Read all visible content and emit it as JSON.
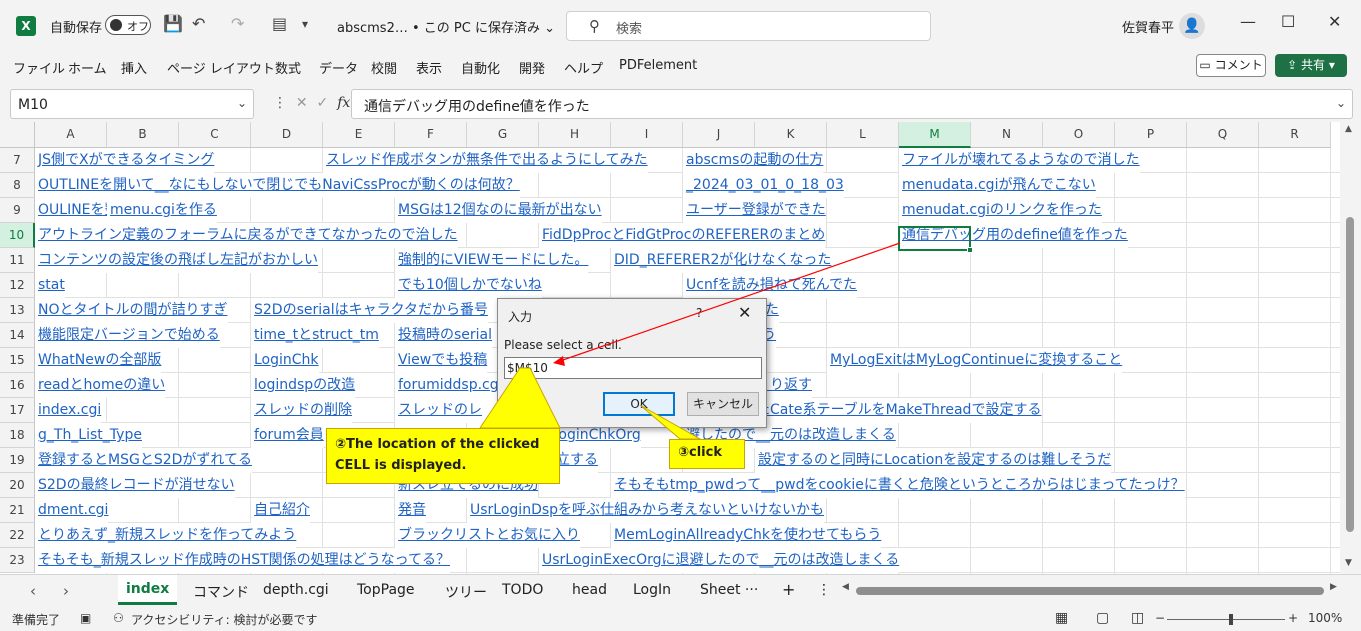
{
  "titlebar": {
    "app_icon": "X",
    "autosave_label": "自動保存",
    "autosave_state": "オフ",
    "doc_title": "abscms2… • この PC に保存済み ⌄",
    "search_placeholder": "検索",
    "user_name": "佐賀春平"
  },
  "ribbon": {
    "tabs": [
      "ファイル",
      "ホーム",
      "挿入",
      "ページ レイアウト",
      "数式",
      "データ",
      "校閲",
      "表示",
      "自動化",
      "開発",
      "ヘルプ",
      "PDFelement"
    ],
    "comment_label": "コメント",
    "share_label": "共有"
  },
  "formula_bar": {
    "name_box": "M10",
    "value": "通信デバッグ用のdefine値を作った"
  },
  "grid": {
    "columns": [
      "A",
      "B",
      "C",
      "D",
      "E",
      "F",
      "G",
      "H",
      "I",
      "J",
      "K",
      "L",
      "M",
      "N",
      "O",
      "P",
      "Q",
      "R"
    ],
    "selected_column": "M",
    "rows": [
      "7",
      "8",
      "9",
      "10",
      "11",
      "12",
      "13",
      "14",
      "15",
      "16",
      "17",
      "18",
      "19",
      "20",
      "21",
      "22",
      "23"
    ],
    "selected_row": "10",
    "cells": [
      {
        "row": "7",
        "col": "A",
        "text": "JS側でXができるタイミング"
      },
      {
        "row": "7",
        "col": "E",
        "text": "スレッド作成ボタンが無条件で出るようにしてみた"
      },
      {
        "row": "7",
        "col": "J",
        "text": "abscmsの起動の仕方"
      },
      {
        "row": "7",
        "col": "M",
        "text": "ファイルが壊れてるようなので消した"
      },
      {
        "row": "8",
        "col": "A",
        "text": "OUTLINEを開いて__なにもしないで閉じでもNaviCssProcが動くのは何故？"
      },
      {
        "row": "8",
        "col": "J",
        "text": "_2024_03_01_0_18_03"
      },
      {
        "row": "8",
        "col": "M",
        "text": "menudata.cgiが飛んでこない"
      },
      {
        "row": "9",
        "col": "A",
        "text": "OULINEを整理せよ"
      },
      {
        "row": "9",
        "col": "B",
        "text": "menu.cgiを作る"
      },
      {
        "row": "9",
        "col": "F",
        "text": "MSGは12個なのに最新が出ない"
      },
      {
        "row": "9",
        "col": "J",
        "text": "ユーザー登録ができた"
      },
      {
        "row": "9",
        "col": "M",
        "text": "menudat.cgiのリンクを作った"
      },
      {
        "row": "10",
        "col": "A",
        "text": "アウトライン定義のフォーラムに戻るができてなかったので治した"
      },
      {
        "row": "10",
        "col": "H",
        "text": "FidDpProcとFidGtProcのREFERERのまとめ"
      },
      {
        "row": "10",
        "col": "M",
        "text": "通信デバッグ用のdefine値を作った"
      },
      {
        "row": "11",
        "col": "A",
        "text": "コンテンツの設定後の飛ばし左記がおかしい"
      },
      {
        "row": "11",
        "col": "F",
        "text": "強制的にVIEWモードにした。"
      },
      {
        "row": "11",
        "col": "I",
        "text": "DID_REFERER2が化けなくなった"
      },
      {
        "row": "12",
        "col": "A",
        "text": "stat"
      },
      {
        "row": "12",
        "col": "F",
        "text": "でも10個しかでないね"
      },
      {
        "row": "12",
        "col": "J",
        "text": "Ucnfを読み損ねて死んでた"
      },
      {
        "row": "13",
        "col": "A",
        "text": "NOとタイトルの間が詰りすぎ"
      },
      {
        "row": "13",
        "col": "D",
        "text": "S2Dのserialはキャラクタだから番号"
      },
      {
        "row": "13",
        "col": "J",
        "text": "pを表示できた"
      },
      {
        "row": "14",
        "col": "A",
        "text": "機能限定バージョンで始める"
      },
      {
        "row": "14",
        "col": "D",
        "text": "time_tとstruct_tm"
      },
      {
        "row": "14",
        "col": "F",
        "text": "投稿時のserial"
      },
      {
        "row": "14",
        "col": "J",
        "text": "らsidを取ろう"
      },
      {
        "row": "15",
        "col": "A",
        "text": "WhatNewの全部版"
      },
      {
        "row": "15",
        "col": "D",
        "text": "LoginChk"
      },
      {
        "row": "15",
        "col": "F",
        "text": "Viewでも投稿"
      },
      {
        "row": "15",
        "col": "L",
        "text": "MyLogExitはMyLogContinueに変換すること"
      },
      {
        "row": "16",
        "col": "A",
        "text": "readとhomeの違い"
      },
      {
        "row": "16",
        "col": "D",
        "text": "logindspの改造"
      },
      {
        "row": "16",
        "col": "F",
        "text": "forumiddsp.cg"
      },
      {
        "row": "16",
        "col": "J",
        "text": "ックをひっくり返す"
      },
      {
        "row": "17",
        "col": "A",
        "text": "index.cgi"
      },
      {
        "row": "17",
        "col": "D",
        "text": "スレッドの削除"
      },
      {
        "row": "17",
        "col": "F",
        "text": "スレッドのレ"
      },
      {
        "row": "17",
        "col": "J",
        "text": "た切り直したCate系テーブルをMakeThreadで設定する"
      },
      {
        "row": "18",
        "col": "A",
        "text": "g_Th_List_Type"
      },
      {
        "row": "18",
        "col": "D",
        "text": "forum会員"
      },
      {
        "row": "18",
        "col": "H",
        "text": "nLoginChkOrg"
      },
      {
        "row": "18",
        "col": "J",
        "text": "避したので__元のは改造しまくる"
      },
      {
        "row": "19",
        "col": "A",
        "text": "登録するとMSGとS2Dがずれてる"
      },
      {
        "row": "19",
        "col": "H",
        "text": "確立する"
      },
      {
        "row": "19",
        "col": "K",
        "text": "設定するのと同時にLocationを設定するのは難しそうだ"
      },
      {
        "row": "20",
        "col": "A",
        "text": "S2Dの最終レコードが消せない"
      },
      {
        "row": "20",
        "col": "F",
        "text": "新スレ立てるのに成功"
      },
      {
        "row": "20",
        "col": "I",
        "text": "そもそもtmp_pwdって__pwdをcookieに書くと危険というところからはじまってたっけ？"
      },
      {
        "row": "21",
        "col": "A",
        "text": "dment.cgi"
      },
      {
        "row": "21",
        "col": "D",
        "text": "自己紹介"
      },
      {
        "row": "21",
        "col": "F",
        "text": "発音"
      },
      {
        "row": "21",
        "col": "G",
        "text": "UsrLoginDspを呼ぶ仕組みから考えないといけないかも"
      },
      {
        "row": "22",
        "col": "A",
        "text": "とりあえず_新規スレッドを作ってみよう"
      },
      {
        "row": "22",
        "col": "F",
        "text": "ブラックリストとお気に入り"
      },
      {
        "row": "22",
        "col": "I",
        "text": "MemLoginAllreadyChkを使わせてもらう"
      },
      {
        "row": "23",
        "col": "A",
        "text": "そもそも_新規スレッド作成時のHST関係の処理はどうなってる？"
      },
      {
        "row": "23",
        "col": "H",
        "text": "UsrLoginExecOrgに退避したので__元のは改造しまくる"
      }
    ]
  },
  "dialog": {
    "title": "入力",
    "help": "?",
    "close": "✕",
    "prompt": "Please select a cell.",
    "input_value": "$M$10",
    "ok_label": "OK",
    "cancel_label": "キャンセル"
  },
  "annotations": {
    "callout1": "②The location of the clicked CELL is displayed.",
    "callout2": "③click",
    "arrow_color": "#ff0000",
    "callout_color": "#ffff00"
  },
  "sheet_tabs": {
    "tabs": [
      "index",
      "コマンド",
      "depth.cgi",
      "TopPage",
      "ツリー",
      "TODO",
      "head",
      "LogIn",
      "Sheet ···"
    ],
    "active": "index",
    "add": "+",
    "more": "⋮"
  },
  "statusbar": {
    "ready": "準備完了",
    "accessibility": "アクセシビリティ: 検討が必要です",
    "zoom": "100%"
  },
  "colors": {
    "excel_green": "#107c41",
    "link_blue": "#1f63c4"
  }
}
